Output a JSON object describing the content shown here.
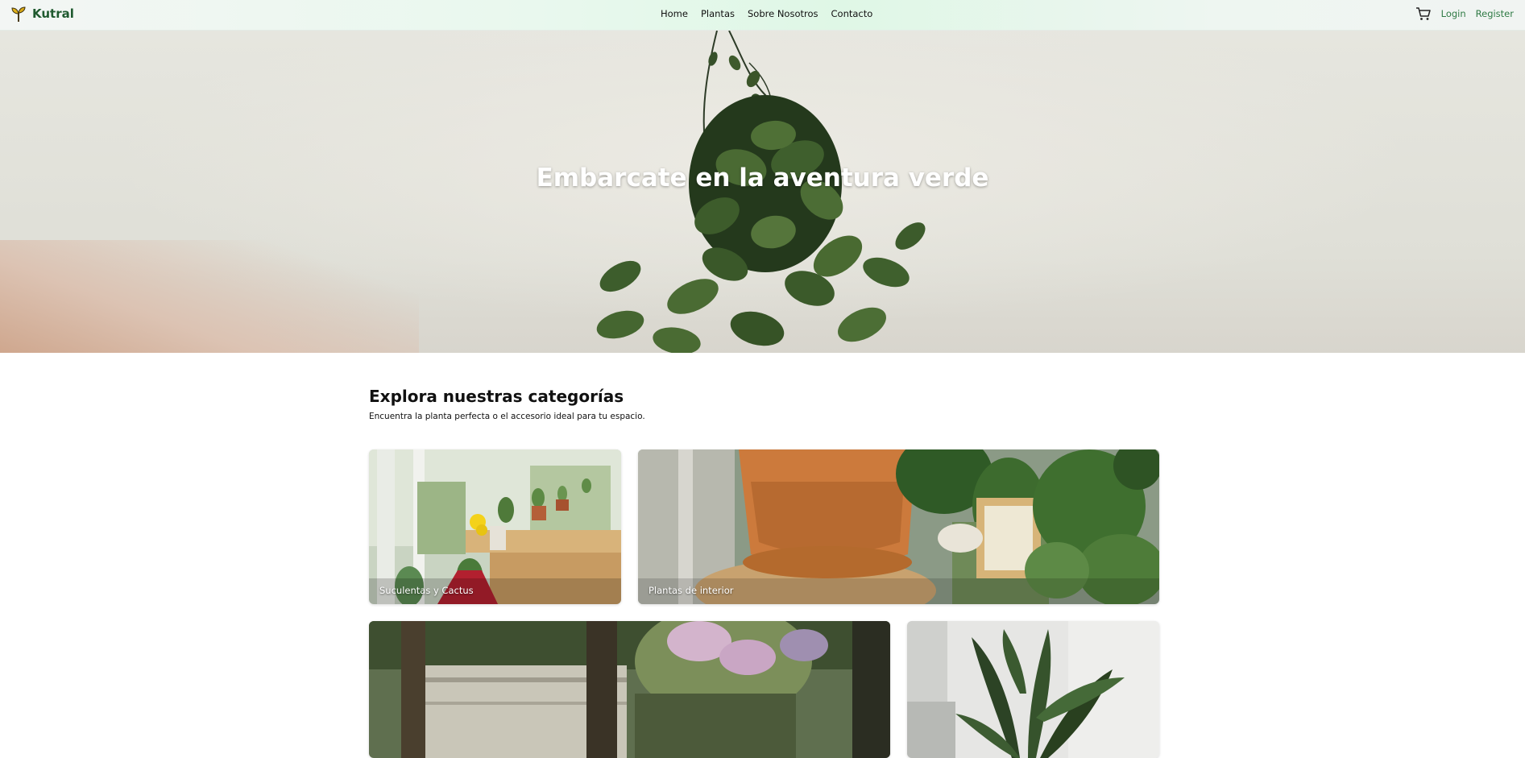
{
  "navbar": {
    "brand": "Kutral",
    "links": [
      "Home",
      "Plantas",
      "Sobre Nosotros",
      "Contacto"
    ],
    "login": "Login",
    "register": "Register",
    "icons": [
      "sprout-logo-icon",
      "cart-icon"
    ]
  },
  "hero": {
    "title": "Embarcate en la aventura verde"
  },
  "categories": {
    "title": "Explora nuestras categorías",
    "subtitle": "Encuentra la planta perfecta o el accesorio ideal para tu espacio.",
    "items": [
      {
        "label": "Suculentas y Cactus"
      },
      {
        "label": "Plantas de interior"
      },
      {
        "label": ""
      },
      {
        "label": ""
      }
    ]
  },
  "colors": {
    "brand": "#1f5a2f",
    "accent": "#2f7a45",
    "navbar_bg": "#e3f7e9"
  }
}
